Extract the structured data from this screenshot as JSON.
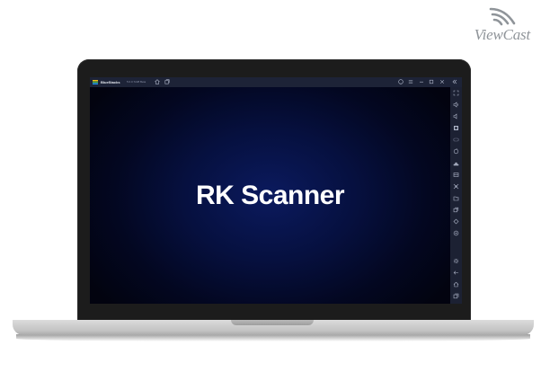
{
  "logo": {
    "brand": "ViewCast",
    "icon": "wifi-signal-icon"
  },
  "window": {
    "app_name": "BlueStacks",
    "version": "5.0.0.7228 Beta",
    "titlebar_icons": [
      "home-icon",
      "multi-instance-icon"
    ],
    "controls": [
      "help-icon",
      "menu-icon",
      "minimize-icon",
      "maximize-icon",
      "close-icon",
      "collapse-sidebar-icon"
    ]
  },
  "content": {
    "title": "RK Scanner"
  },
  "sidebar": {
    "items": [
      "fullscreen-icon",
      "volume-up-icon",
      "volume-down-icon",
      "keymap-icon",
      "gamepad-icon",
      "rotate-icon",
      "install-apk-icon",
      "media-manager-icon",
      "screenshot-icon",
      "folder-icon",
      "multi-instance-icon",
      "eco-mode-icon",
      "macro-icon",
      "settings-icon",
      "back-icon",
      "home-icon",
      "recent-apps-icon"
    ]
  },
  "colors": {
    "titlebar": "#1d2337",
    "sidebar": "#1c2133",
    "viewport_center": "#0b1a5e",
    "text": "#ffffff"
  }
}
